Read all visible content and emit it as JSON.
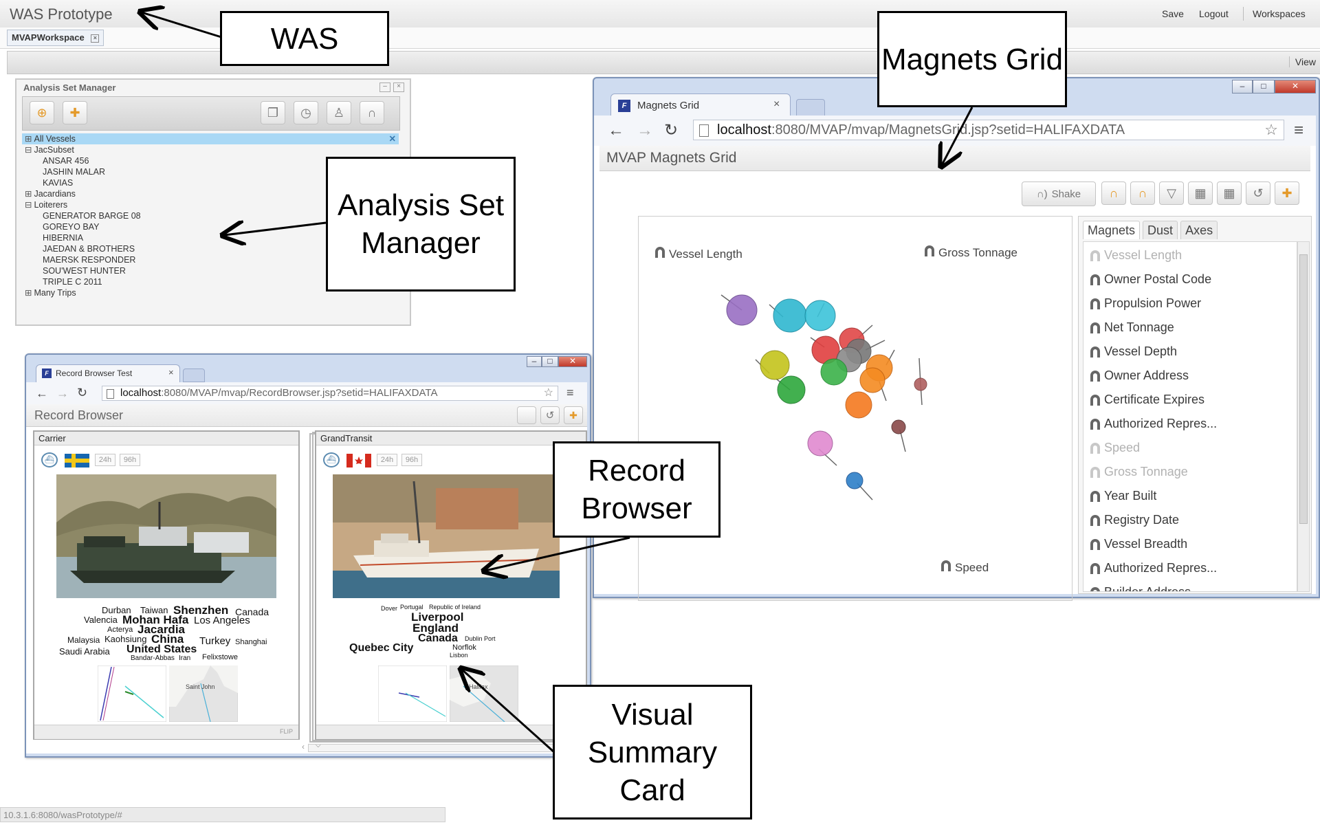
{
  "app": {
    "title": "WAS Prototype",
    "save": "Save",
    "logout": "Logout",
    "workspaces": "Workspaces",
    "workspace_tab": "MVAPWorkspace",
    "view": "View",
    "status_url": "10.3.1.6:8080/wasPrototype/#"
  },
  "asm": {
    "title": "Analysis Set Manager",
    "items": [
      {
        "label": "All Vessels",
        "level": 0,
        "toggle": "⊞",
        "selected": true
      },
      {
        "label": "JacSubset",
        "level": 0,
        "toggle": "⊟"
      },
      {
        "label": "ANSAR 456",
        "level": 1
      },
      {
        "label": "JASHIN MALAR",
        "level": 1
      },
      {
        "label": "KAVIAS",
        "level": 1
      },
      {
        "label": "Jacardians",
        "level": 0,
        "toggle": "⊞"
      },
      {
        "label": "Loiterers",
        "level": 0,
        "toggle": "⊟"
      },
      {
        "label": "GENERATOR BARGE 08",
        "level": 1
      },
      {
        "label": "GOREYO BAY",
        "level": 1
      },
      {
        "label": "HIBERNIA",
        "level": 1
      },
      {
        "label": "JAEDAN & BROTHERS",
        "level": 1
      },
      {
        "label": "MAERSK RESPONDER",
        "level": 1
      },
      {
        "label": "SOU'WEST HUNTER",
        "level": 1
      },
      {
        "label": "TRIPLE C 2011",
        "level": 1
      },
      {
        "label": "Many Trips",
        "level": 0,
        "toggle": "⊞"
      }
    ]
  },
  "magnets_window": {
    "tab_title": "Magnets Grid",
    "url_host": "localhost",
    "url_rest": ":8080/MVAP/mvap/MagnetsGrid.jsp?setid=HALIFAXDATA",
    "page_title": "MVAP Magnets Grid",
    "shake_label": "Shake",
    "placed_magnets": [
      "Vessel Length",
      "Gross Tonnage",
      "Speed"
    ],
    "tabs": [
      "Magnets",
      "Dust",
      "Axes"
    ],
    "magnet_list": [
      {
        "label": "Vessel Length",
        "dim": true
      },
      {
        "label": "Owner Postal Code",
        "dim": false
      },
      {
        "label": "Propulsion Power",
        "dim": false
      },
      {
        "label": "Net Tonnage",
        "dim": false
      },
      {
        "label": "Vessel Depth",
        "dim": false
      },
      {
        "label": "Owner Address",
        "dim": false
      },
      {
        "label": "Certificate Expires",
        "dim": false
      },
      {
        "label": "Authorized Repres...",
        "dim": false
      },
      {
        "label": "Speed",
        "dim": true
      },
      {
        "label": "Gross Tonnage",
        "dim": true
      },
      {
        "label": "Year Built",
        "dim": false
      },
      {
        "label": "Registry Date",
        "dim": false
      },
      {
        "label": "Vessel Breadth",
        "dim": false
      },
      {
        "label": "Authorized Repres...",
        "dim": false
      },
      {
        "label": "Builder Address",
        "dim": false
      }
    ]
  },
  "record_window": {
    "tab_title": "Record Browser Test",
    "url_host": "localhost",
    "url_rest": ":8080/MVAP/mvap/RecordBrowser.jsp?setid=HALIFAXDATA",
    "page_title": "Record Browser",
    "btn_24h": "24h",
    "btn_96h": "96h",
    "flip": "FLIP",
    "map_label_1": "Saint John",
    "map_label_2": "Halifax",
    "cards": [
      {
        "name": "Carrier",
        "flag": "sweden"
      },
      {
        "name": "GrandTransit",
        "flag": "canada"
      }
    ],
    "cloud1": [
      "Durban",
      "Taiwan",
      "Shenzhen",
      "Canada",
      "Valencia",
      "Mohan Hafa",
      "Los Angeles",
      "Acterya",
      "Jacardia",
      "Malaysia",
      "Kaohsiung",
      "China",
      "Turkey",
      "Shanghai",
      "Saudi Arabia",
      "United States",
      "Bandar-Abbas",
      "Iran",
      "Felixstowe"
    ],
    "cloud2": [
      "Dover",
      "Portugal",
      "Republic of Ireland",
      "Liverpool",
      "England",
      "Canada",
      "Dublin Port",
      "Quebec City",
      "Norflok",
      "Lisbon"
    ]
  },
  "callouts": {
    "was": "WAS",
    "magnets_grid": "Magnets Grid",
    "analysis_set_manager": "Analysis Set Manager",
    "record_browser": "Record Browser",
    "visual_summary_card": "Visual Summary Card"
  },
  "colors": {
    "selection": "#a9d8f5",
    "window_frame": "#7c93b8"
  }
}
